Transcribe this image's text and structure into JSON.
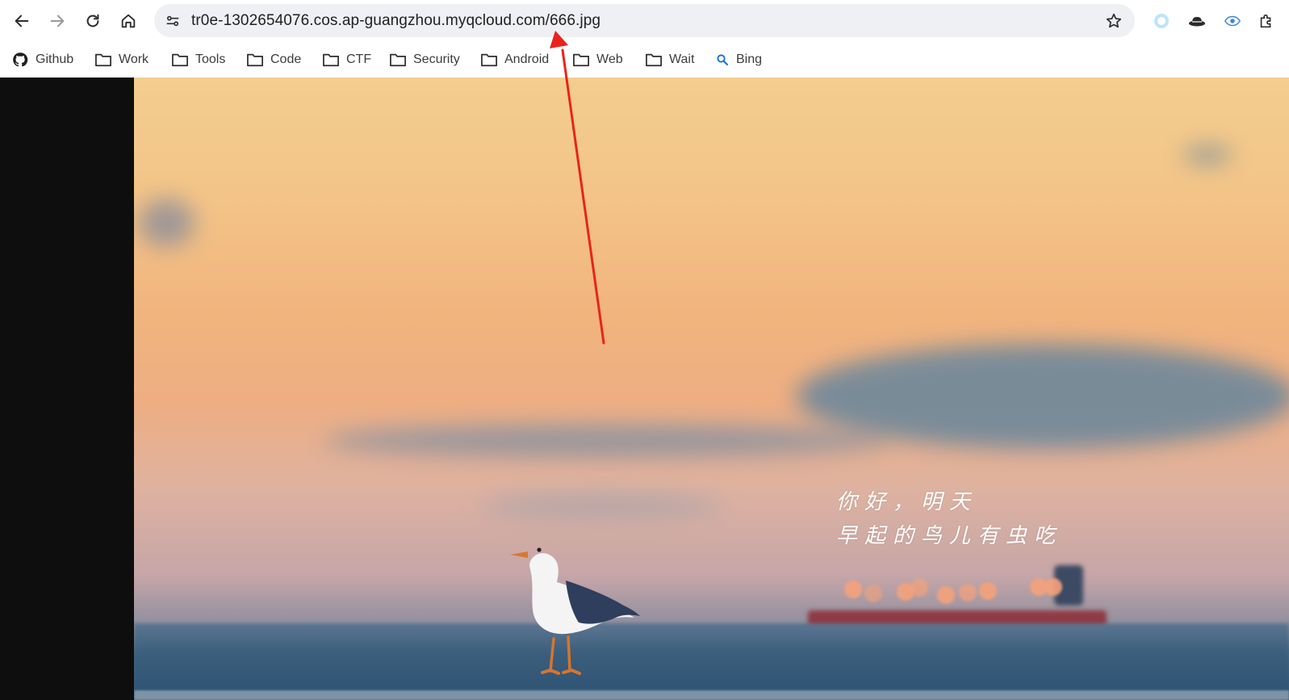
{
  "browser": {
    "url": "tr0e-1302654076.cos.ap-guangzhou.myqcloud.com/666.jpg"
  },
  "bookmarks": [
    {
      "label": "Github",
      "icon": "github-icon"
    },
    {
      "label": "Work",
      "icon": "folder-icon"
    },
    {
      "label": "Tools",
      "icon": "folder-icon"
    },
    {
      "label": "Code",
      "icon": "folder-icon"
    },
    {
      "label": "CTF",
      "icon": "folder-icon"
    },
    {
      "label": "Security",
      "icon": "folder-icon"
    },
    {
      "label": "Android",
      "icon": "folder-icon"
    },
    {
      "label": "Web",
      "icon": "folder-icon"
    },
    {
      "label": "Wait",
      "icon": "folder-icon"
    },
    {
      "label": "Bing",
      "icon": "search-icon"
    }
  ],
  "image": {
    "quote_line1": "你好，明天",
    "quote_line2": "早起的鸟儿有虫吃"
  },
  "annotation": {
    "color": "#e8241d"
  }
}
